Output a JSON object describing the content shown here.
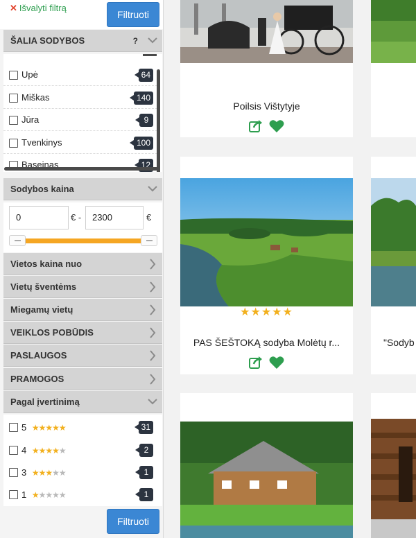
{
  "sidebar": {
    "clear_filter": "Išvalyti filtrą",
    "filter_button_top": "Filtruoti",
    "filter_button_bottom": "Filtruoti",
    "near_section": {
      "title": "ŠALIA SODYBOS",
      "help": "?",
      "items": [
        {
          "label": "Upė",
          "count": "64"
        },
        {
          "label": "Miškas",
          "count": "140"
        },
        {
          "label": "Jūra",
          "count": "9"
        },
        {
          "label": "Tvenkinys",
          "count": "100"
        },
        {
          "label": "Baseinas",
          "count": "12"
        }
      ]
    },
    "price_section": {
      "title": "Sodybos kaina",
      "min_value": "0",
      "max_value": "2300",
      "currency_min": "€ -",
      "currency_max": "€",
      "range_low_fraction": 0,
      "range_high_fraction": 1
    },
    "collapsed_sections": [
      "Vietos kaina nuo",
      "Vietų šventėms",
      "Miegamų vietų",
      "VEIKLOS POBŪDIS",
      "PASLAUGOS",
      "PRAMOGOS"
    ],
    "rating_section": {
      "title": "Pagal įvertinimą",
      "items": [
        {
          "label": "5",
          "filled": 5,
          "count": "31"
        },
        {
          "label": "4",
          "filled": 4,
          "count": "2"
        },
        {
          "label": "3",
          "filled": 3,
          "count": "1"
        },
        {
          "label": "1",
          "filled": 1,
          "count": "1"
        }
      ]
    }
  },
  "cards": [
    {
      "title": "Poilsis Vištytyje",
      "rating": 0
    },
    {
      "title": "PAS ŠEŠTOKĄ sodyba Molėtų r...",
      "rating": 5
    },
    {
      "title": "\"Sodyb",
      "rating": 0
    },
    {
      "title": "",
      "rating": 0
    }
  ],
  "icons": {
    "share": "share-icon",
    "favorite": "heart-icon",
    "chevron_down": "chevron-down-icon",
    "chevron_right": "chevron-right-icon",
    "clear": "close-icon"
  },
  "colors": {
    "accent_blue": "#3b87d4",
    "action_green": "#2e9e4f",
    "star_gold": "#f2b01e",
    "slider_orange": "#f5a623",
    "badge_dark": "#2c3440"
  }
}
